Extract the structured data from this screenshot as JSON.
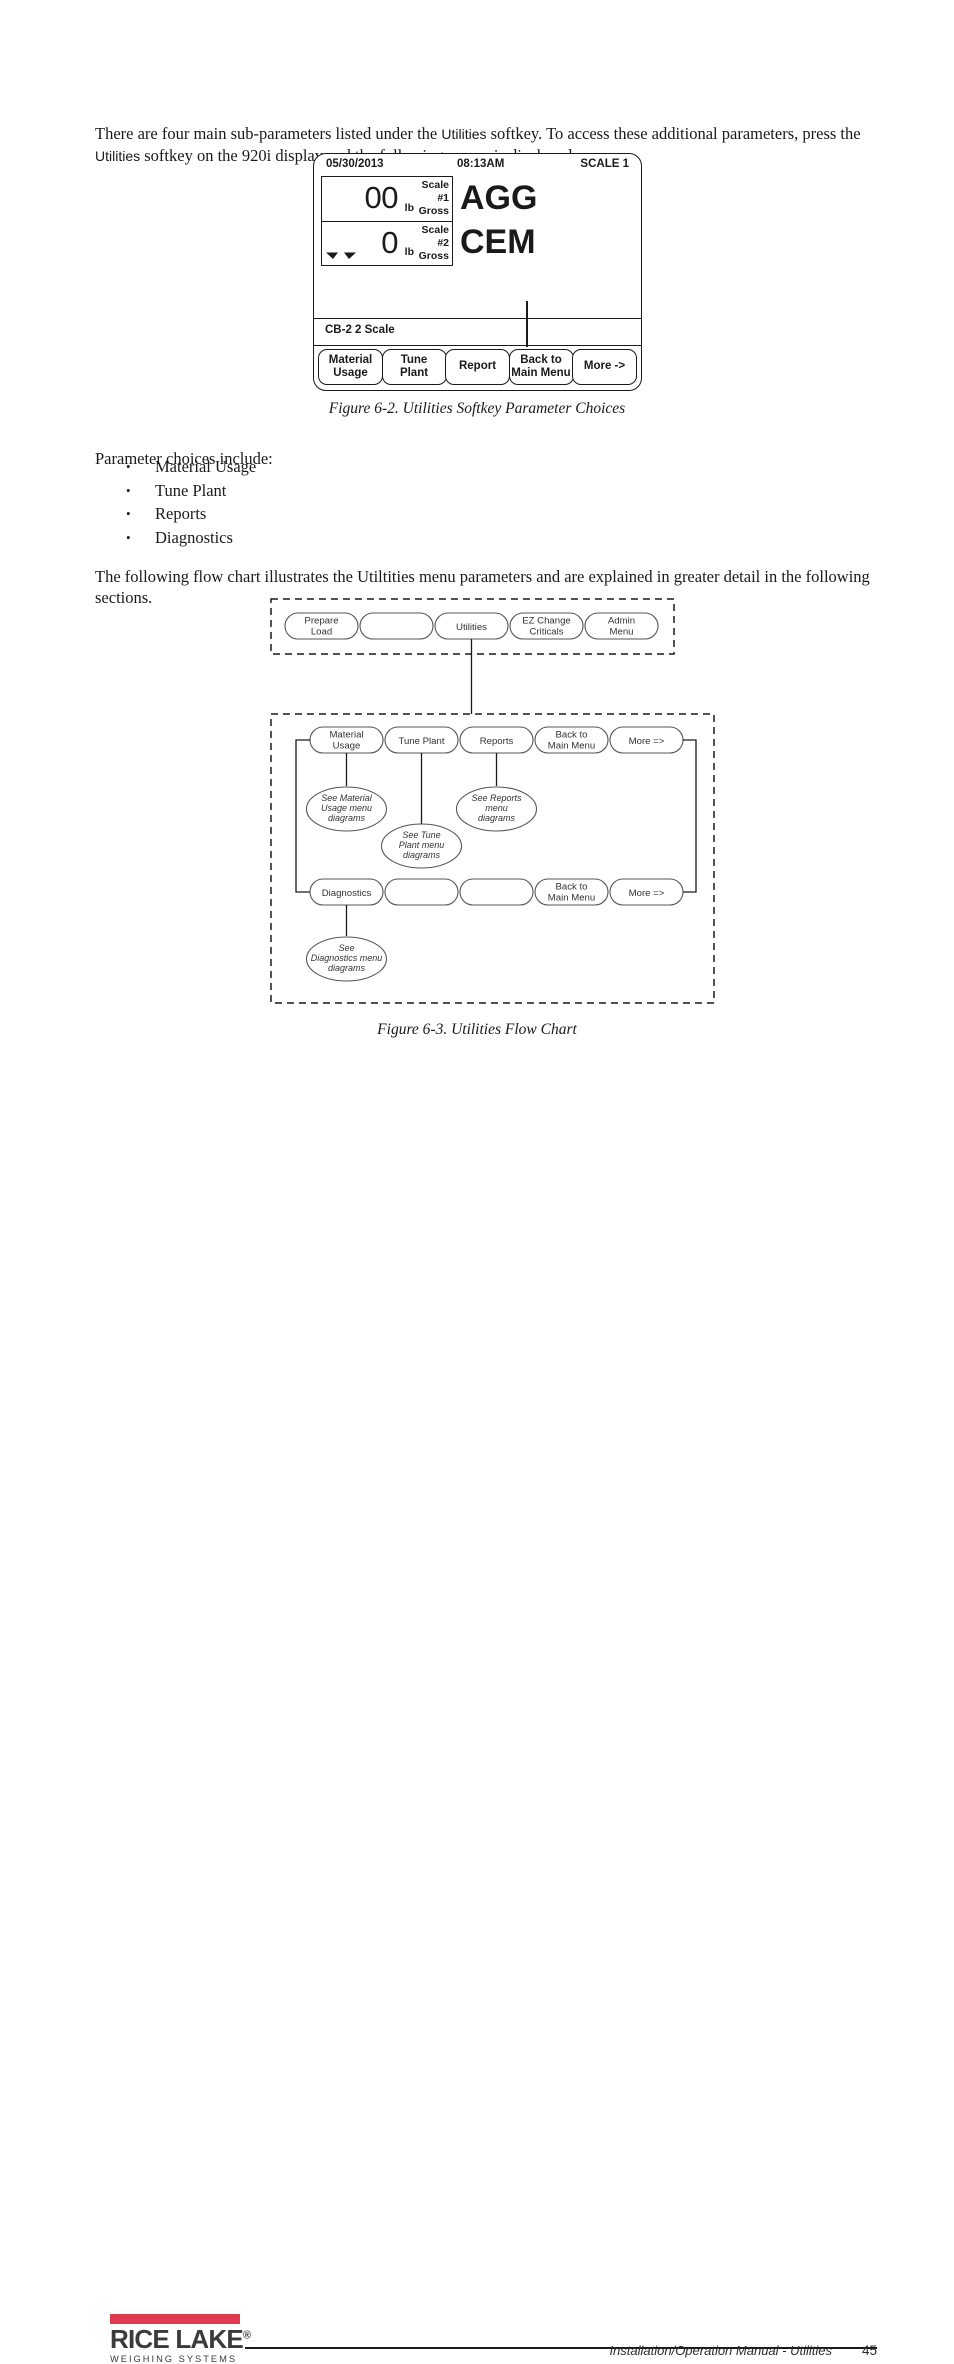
{
  "body_text": {
    "intro_before_1": "There are four main sub-parameters listed under the ",
    "intro_term_1": "Utilities",
    "intro_mid_1": " softkey. To access these additional parameters, press the ",
    "intro_term_2": "Utilities",
    "intro_after": " softkey on the 920i display and the following screen is displayed.",
    "choices_label": "Parameter choices include:",
    "flow_intro": "The following flow chart illustrates the Utiltities menu parameters and are explained in greater detail in the following sections."
  },
  "bullets": [
    "Material Usage",
    "Tune Plant",
    "Reports",
    "Diagnostics"
  ],
  "captions": {
    "figure_6_2": "Figure 6-2. Utilities Softkey Parameter Choices",
    "figure_6_3": "Figure 6-3. Utilities Flow Chart"
  },
  "indicator": {
    "date": "05/30/2013",
    "time": "08:13AM",
    "scale_indicator": "SCALE 1",
    "weights": [
      {
        "value": "00",
        "unit": "lb",
        "label_line1": "Scale",
        "label_line2": "#1",
        "label_line3": "Gross",
        "legend": "AGG"
      },
      {
        "value": "0",
        "unit": "lb",
        "label_line1": "Scale",
        "label_line2": "#2",
        "label_line3": "Gross",
        "legend": "CEM"
      }
    ],
    "status_text": "CB-2  2 Scale",
    "softkeys": [
      "Material\nUsage",
      "Tune\nPlant",
      "Report",
      "Back to\nMain Menu",
      "More ->"
    ]
  },
  "flow_chart": {
    "group_main_menu": {
      "nodes": [
        "Prepare\nLoad",
        "",
        "Utilities",
        "EZ Change\nCriticals",
        "Admin\nMenu"
      ]
    },
    "group_utilities": {
      "row1": [
        "Material\nUsage",
        "Tune Plant",
        "Reports",
        "Back to\nMain Menu",
        "More =>"
      ],
      "row2": [
        "Diagnostics",
        "",
        "",
        "Back to\nMain Menu",
        "More =>"
      ],
      "ellipses": [
        "See Material\nUsage menu\ndiagrams",
        "See Tune\nPlant menu\ndiagrams",
        "See Reports\nmenu\ndiagrams",
        "See\nDiagnostics menu\ndiagrams"
      ]
    }
  },
  "footer": {
    "logo_name": "RICE LAKE",
    "logo_trademark": "®",
    "logo_subtitle": "WEIGHING SYSTEMS",
    "manual_text": "Installation/Operation Manual - Utilities",
    "page_number": "45"
  },
  "colors": {
    "brand_red": "#e03a4e",
    "ink": "#1a1a1a",
    "flow_stroke": "#555555"
  }
}
